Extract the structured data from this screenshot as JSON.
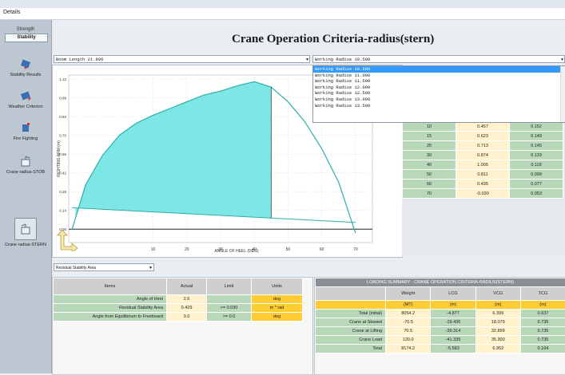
{
  "window": {
    "title": "Details"
  },
  "sidebar": {
    "tabs": [
      {
        "label": "Strength"
      },
      {
        "label": "Stability"
      }
    ],
    "items": [
      {
        "label": "Stability Results",
        "icon": "stability-results-icon"
      },
      {
        "label": "Weather Criterion",
        "icon": "weather-criterion-icon"
      },
      {
        "label": "Fire Fighting",
        "icon": "fire-fighting-icon"
      },
      {
        "label": "Crane radius-STOB",
        "icon": "crane-stob-icon"
      },
      {
        "label": "Crane radius-STERN",
        "icon": "crane-stern-icon"
      }
    ]
  },
  "page": {
    "title": "Crane Operation Criteria-radius(stern)"
  },
  "boom_length": {
    "value": "Boom Length 21.800"
  },
  "working_radius": {
    "value": "Working Radius 10.500",
    "options": [
      "Working Radius 10.500",
      "Working Radius 11.000",
      "Working Radius 11.500",
      "Working Radius 12.000",
      "Working Radius 12.500",
      "Working Radius 13.000",
      "Working Radius 13.500"
    ]
  },
  "chart_data": {
    "type": "area",
    "xlabel": "ANGLE OF HEEL (DEG)",
    "ylabel": "RIGHTING ARM (m)",
    "xlim": [
      -15,
      75
    ],
    "ylim": [
      -0.1,
      1.15
    ],
    "xticks": [
      10,
      20,
      30,
      40,
      50,
      60,
      70
    ],
    "yticks": [
      1.12,
      0.98,
      0.84,
      0.7,
      0.56,
      0.42,
      0.28,
      0.14,
      0,
      -0.14,
      -0.28
    ],
    "ytick_labels": [
      "1.12",
      "0.98",
      "0.84",
      "0.70",
      "0.56",
      "0.42",
      "0.28",
      "0.14",
      "0.00",
      "-0.14",
      "-0.28"
    ],
    "gz_curve": {
      "x": [
        -14,
        -10,
        -5,
        0,
        5,
        10,
        15,
        20,
        25,
        30,
        35,
        40,
        45,
        50,
        55,
        60,
        65,
        70
      ],
      "y": [
        0.0,
        0.33,
        0.55,
        0.7,
        0.79,
        0.85,
        0.9,
        0.95,
        1.0,
        1.03,
        1.07,
        1.1,
        1.06,
        0.95,
        0.8,
        0.6,
        0.35,
        -0.03
      ]
    },
    "heeling_arm": {
      "x": [
        -14,
        70
      ],
      "y": [
        0.16,
        0.05
      ]
    },
    "shaded_range": [
      -13,
      45
    ],
    "vertical_marker_x": 45,
    "grid": true,
    "colors": {
      "fill": "#7fe6e6",
      "curve": "#2bb0a8",
      "axis": "#000000"
    }
  },
  "crane_table": {
    "rows": [
      [
        "10",
        "0.457",
        "0.152"
      ],
      [
        "15",
        "0.623",
        "0.149"
      ],
      [
        "20",
        "0.713",
        "0.145"
      ],
      [
        "30",
        "0.874",
        "0.133"
      ],
      [
        "40",
        "1.005",
        "0.118"
      ],
      [
        "50",
        "0.811",
        "0.099"
      ],
      [
        "60",
        "0.435",
        "0.077"
      ],
      [
        "70",
        "-0.030",
        "0.053"
      ]
    ]
  },
  "bottom_combo": {
    "value": "Residual Stability Area"
  },
  "results_table": {
    "headers": [
      "Items",
      "Actual",
      "Limit",
      "Units"
    ],
    "rows": [
      [
        "Angle of Heel",
        "2.6",
        "",
        "deg"
      ],
      [
        "Residual Stability Area",
        "0.429",
        ">= 0.030",
        "m * rad"
      ],
      [
        "Angle from Equilibrium to Freeboard",
        "3.0",
        ">= 0.0",
        "deg"
      ]
    ]
  },
  "loading_summary": {
    "title": "LOADING SUMMARY - CRANE OPERATION CRITERIA-RADIUS(STERN)",
    "headers": [
      "Weight",
      "LCG",
      "VCG",
      "TCG"
    ],
    "units": [
      "(MT)",
      "(m)",
      "(m)",
      "(m)"
    ],
    "rows": [
      [
        "Total (initial)",
        "8054.2",
        "-4.877",
        "6.399",
        "0.037"
      ],
      [
        "Crane at Stowed",
        "-70.5",
        "-19.436",
        "18.079",
        "0.735"
      ],
      [
        "Crane at Lifting",
        "70.5",
        "-39.314",
        "32.899",
        "0.735"
      ],
      [
        "Crane Load",
        "120.0",
        "-41.335",
        "35.300",
        "0.735"
      ],
      [
        "Total",
        "8174.2",
        "-5.583",
        "6.952",
        "0.164"
      ]
    ]
  }
}
